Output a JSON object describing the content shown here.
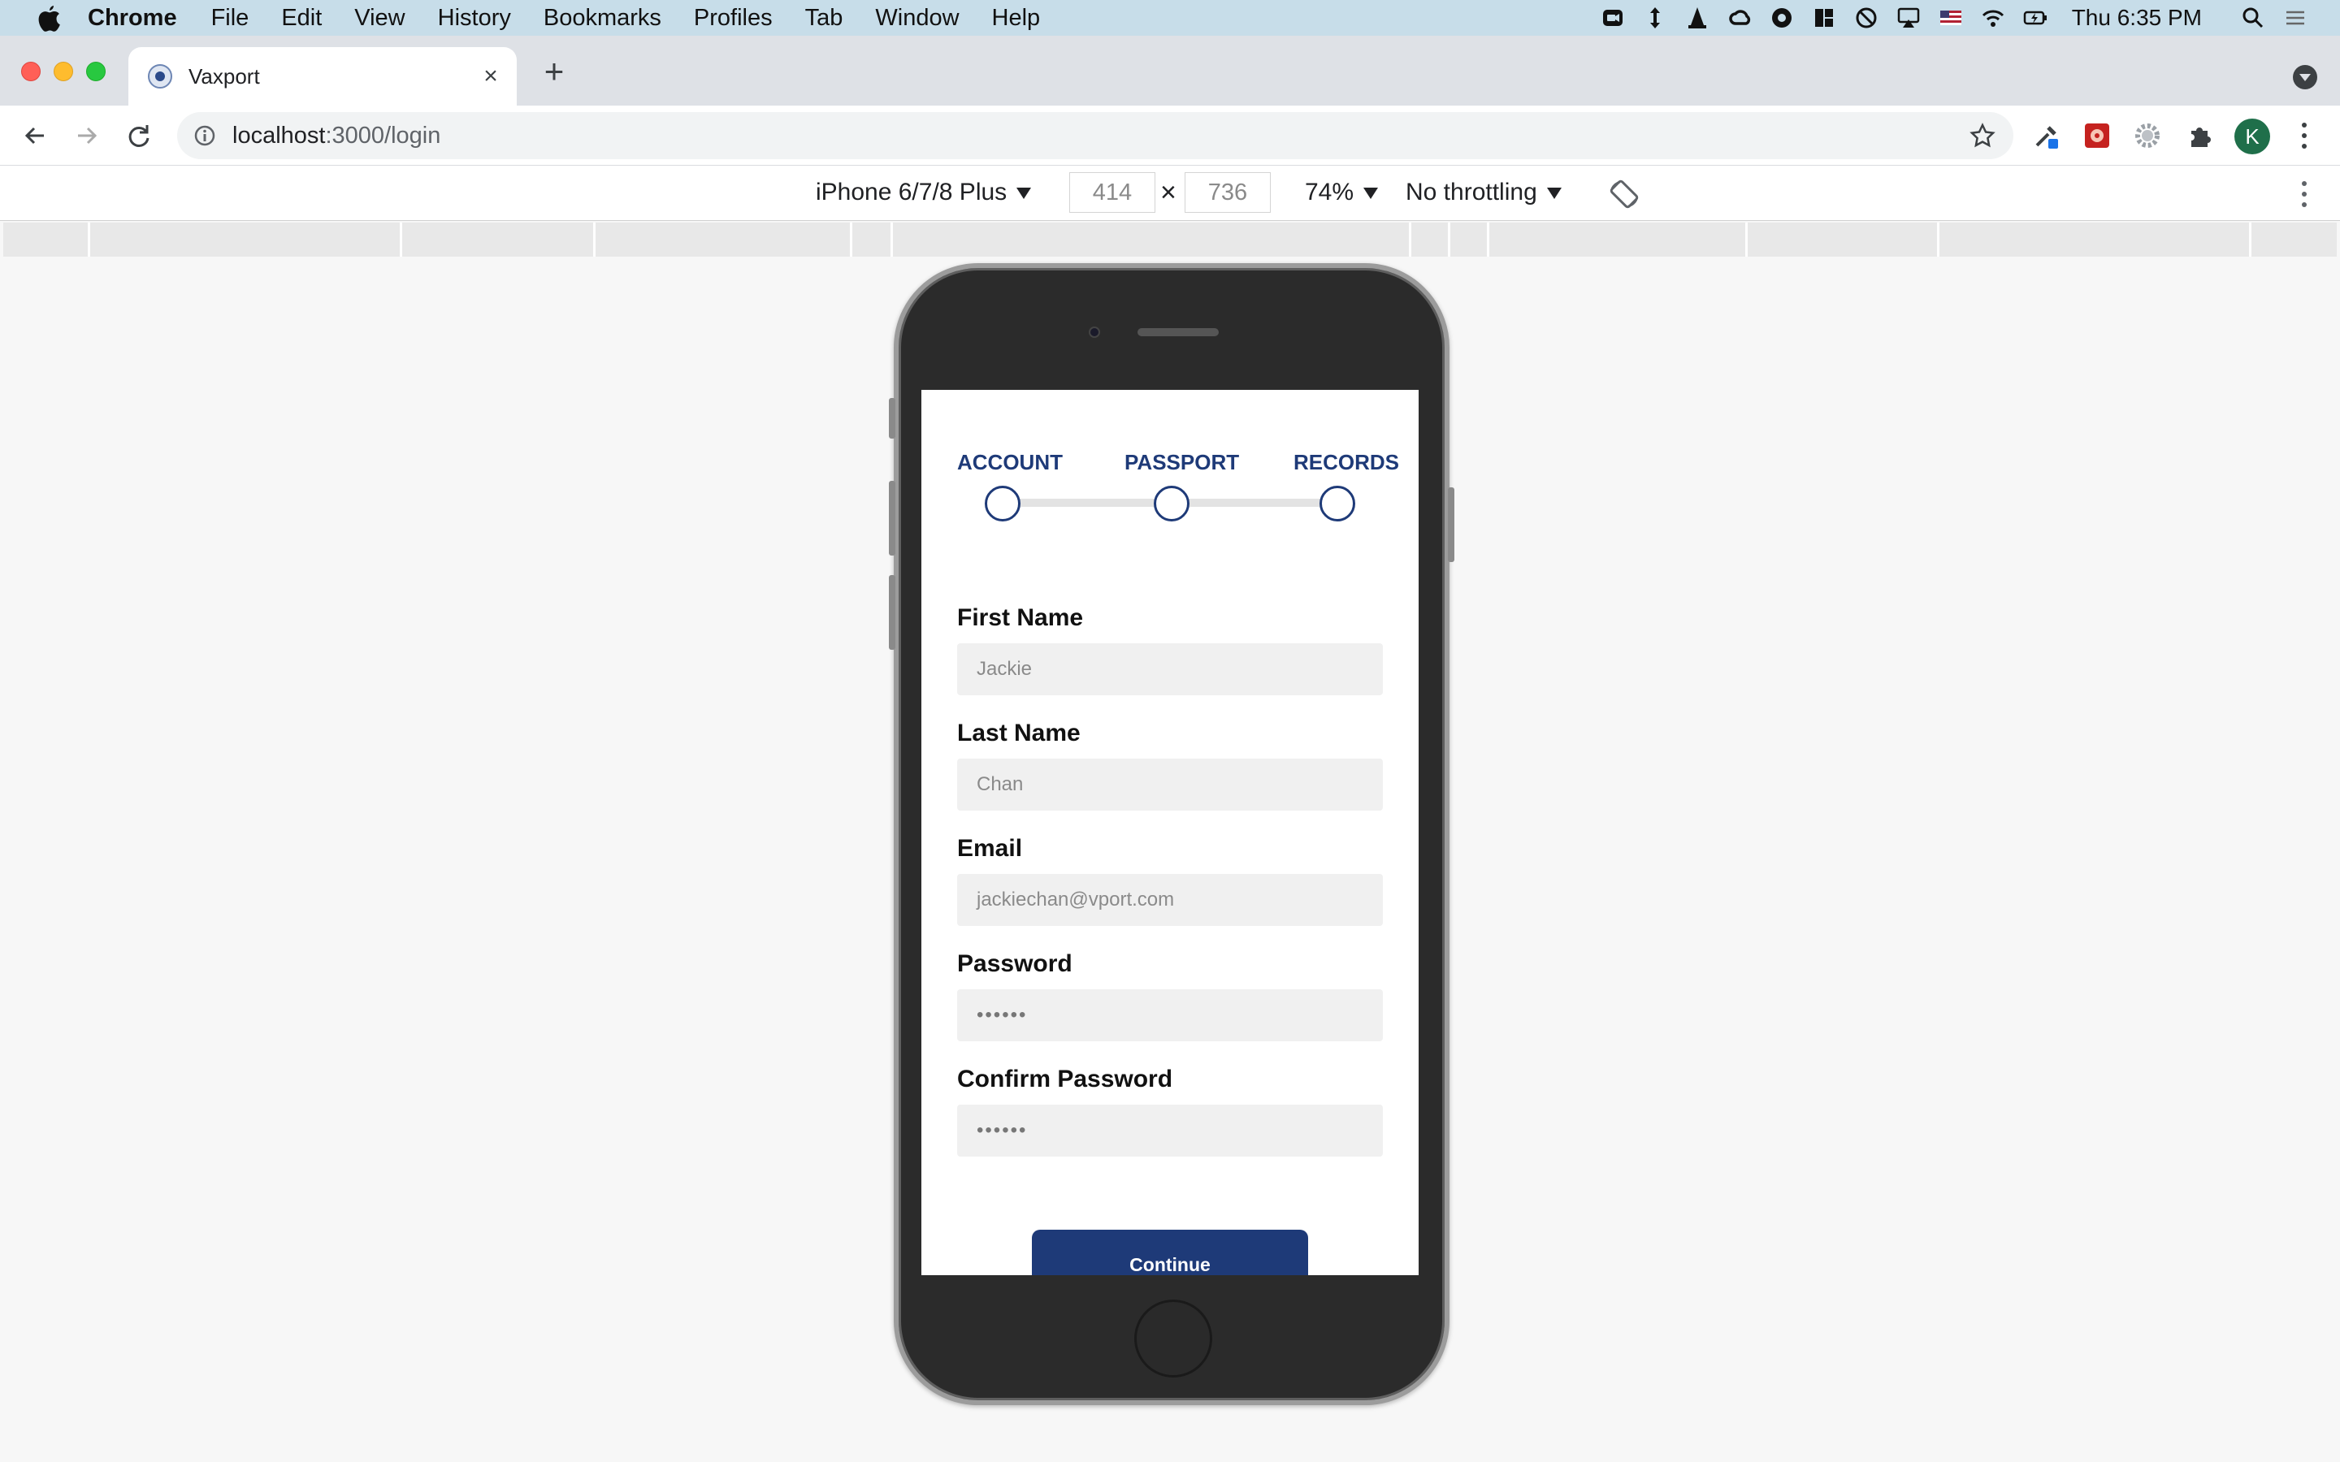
{
  "menubar": {
    "app_name": "Chrome",
    "items": [
      "File",
      "Edit",
      "View",
      "History",
      "Bookmarks",
      "Profiles",
      "Tab",
      "Window",
      "Help"
    ],
    "clock": "Thu 6:35 PM"
  },
  "browser": {
    "tab_title": "Vaxport",
    "tab_close": "×",
    "new_tab": "+",
    "url_host": "localhost",
    "url_path": ":3000/login",
    "profile_initial": "K"
  },
  "device_toolbar": {
    "device": "iPhone 6/7/8 Plus",
    "width": "414",
    "height": "736",
    "times": "×",
    "zoom": "74%",
    "throttling": "No throttling"
  },
  "app": {
    "steps": [
      "ACCOUNT",
      "PASSPORT",
      "RECORDS"
    ],
    "fields": [
      {
        "label": "First Name",
        "placeholder": "Jackie"
      },
      {
        "label": "Last Name",
        "placeholder": "Chan"
      },
      {
        "label": "Email",
        "placeholder": "jackiechan@vport.com"
      },
      {
        "label": "Password",
        "value": "••••••"
      },
      {
        "label": "Confirm Password",
        "value": "••••••"
      }
    ],
    "continue_label": "Continue",
    "accent_color": "#1e3a78"
  }
}
